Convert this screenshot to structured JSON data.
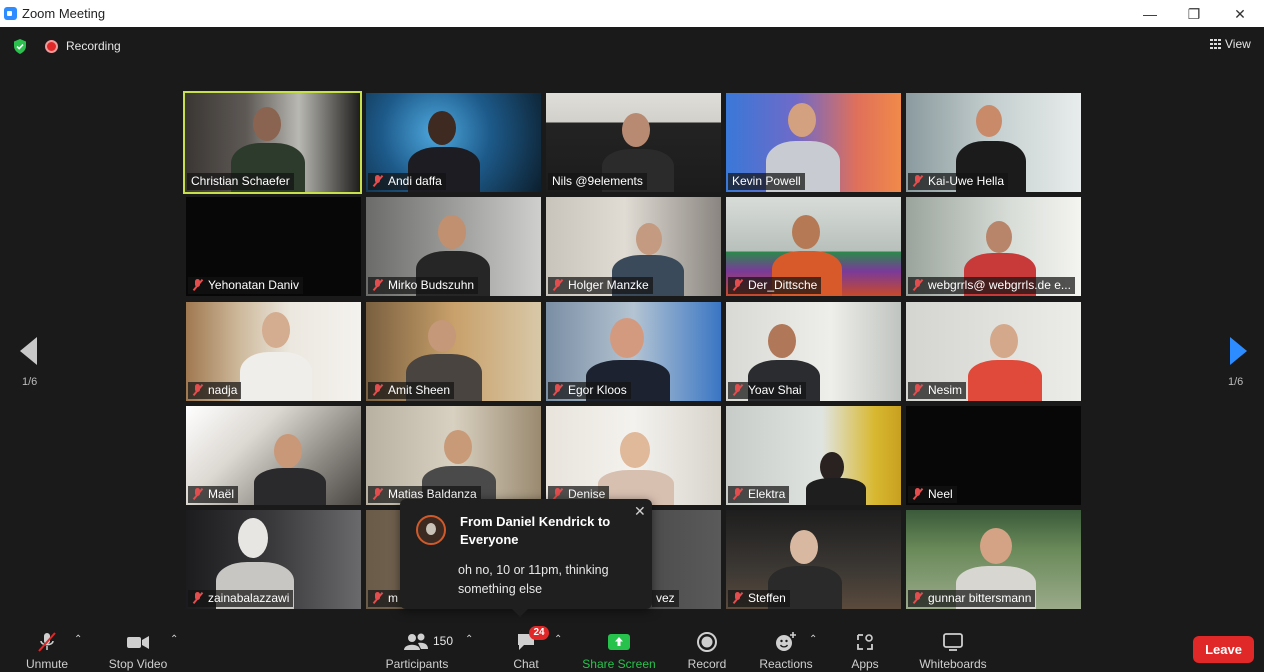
{
  "window": {
    "title": "Zoom Meeting",
    "controls": [
      "minimize",
      "maximize",
      "close"
    ]
  },
  "meeting": {
    "recording_label": "Recording",
    "view_label": "View",
    "page_indicator_left": "1/6",
    "page_indicator_right": "1/6"
  },
  "participants_tiles": [
    {
      "name": "Christian Schaefer",
      "muted": false,
      "active_speaker": true
    },
    {
      "name": "Andi daffa",
      "muted": true
    },
    {
      "name": "Nils @9elements",
      "muted": false
    },
    {
      "name": "Kevin Powell",
      "muted": false
    },
    {
      "name": "Kai-Uwe Hella",
      "muted": true
    },
    {
      "name": "Yehonatan Daniv",
      "muted": true
    },
    {
      "name": "Mirko Budszuhn",
      "muted": true
    },
    {
      "name": "Holger Manzke",
      "muted": true
    },
    {
      "name": "Der_Dittsche",
      "muted": true
    },
    {
      "name": "webgrrls@ webgrrls.de e...",
      "muted": true
    },
    {
      "name": "nadja",
      "muted": true
    },
    {
      "name": "Amit Sheen",
      "muted": true
    },
    {
      "name": "Egor Kloos",
      "muted": true
    },
    {
      "name": "Yoav Shai",
      "muted": true
    },
    {
      "name": "Nesim",
      "muted": true
    },
    {
      "name": "Maël",
      "muted": true
    },
    {
      "name": "Matias Baldanza",
      "muted": true
    },
    {
      "name": "Denise",
      "muted": true
    },
    {
      "name": "Elektra",
      "muted": true
    },
    {
      "name": "Neel",
      "muted": true
    },
    {
      "name": "zainabalazzawi",
      "muted": true
    },
    {
      "name": "m",
      "muted": true
    },
    {
      "name": "vez",
      "muted": false
    },
    {
      "name": "Steffen",
      "muted": true
    },
    {
      "name": "gunnar bittersmann",
      "muted": true
    }
  ],
  "chat_notification": {
    "from": "From Daniel Kendrick to Everyone",
    "message": "oh no, 10 or 11pm, thinking something else"
  },
  "toolbar": {
    "unmute_label": "Unmute",
    "stop_video_label": "Stop Video",
    "participants_label": "Participants",
    "participants_count": "150",
    "chat_label": "Chat",
    "chat_badge": "24",
    "share_screen_label": "Share Screen",
    "record_label": "Record",
    "reactions_label": "Reactions",
    "apps_label": "Apps",
    "whiteboards_label": "Whiteboards",
    "leave_label": "Leave"
  },
  "colors": {
    "active_speaker_outline": "#c8e04a",
    "share_screen_green": "#27c24c",
    "leave_red": "#e02828",
    "nav_arrow_blue": "#2d8cff"
  }
}
